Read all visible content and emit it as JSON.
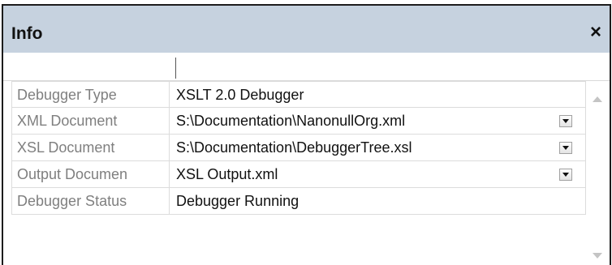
{
  "panel": {
    "title": "Info",
    "close_label": "×"
  },
  "rows": [
    {
      "label": "Debugger Type",
      "value": "XSLT 2.0 Debugger",
      "has_dropdown": false
    },
    {
      "label": "XML Document",
      "value": "S:\\Documentation\\NanonullOrg.xml",
      "has_dropdown": true
    },
    {
      "label": "XSL Document",
      "value": "S:\\Documentation\\DebuggerTree.xsl",
      "has_dropdown": true
    },
    {
      "label": "Output Documen",
      "value": "XSL Output.xml",
      "has_dropdown": true
    },
    {
      "label": "Debugger Status",
      "value": "Debugger Running",
      "has_dropdown": false
    }
  ],
  "colors": {
    "titlebar_bg": "#c6d2df",
    "label_text": "#7f7f7f",
    "value_text": "#111111"
  }
}
